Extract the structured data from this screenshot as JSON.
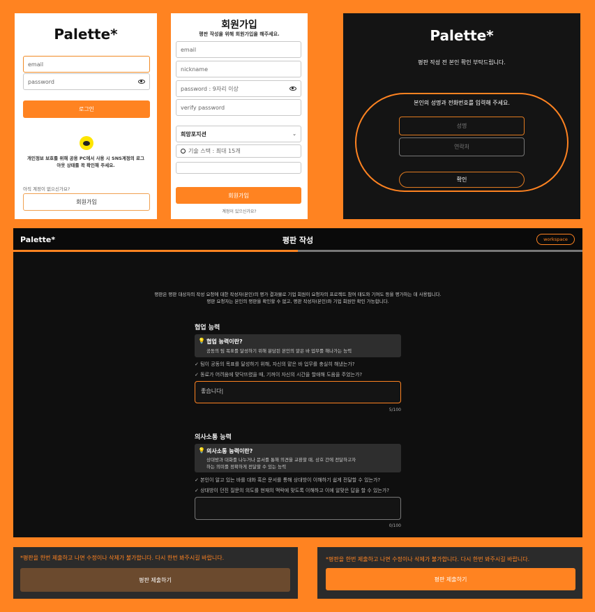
{
  "login": {
    "logo": "Palette*",
    "email_placeholder": "email",
    "password_placeholder": "password",
    "login_button": "로그인",
    "notice": "개인정보 보호를 위해 공용 PC에서 사용 시 SNS계정의 로그아웃 상태를 꼭 확인해 주세요.",
    "no_account": "아직 계정이 없으신가요?",
    "signup_button": "회원가입"
  },
  "signup": {
    "title": "회원가입",
    "subtitle": "평판 작성을 위해 회원가입을 해주세요.",
    "email_placeholder": "email",
    "nickname_placeholder": "nickname",
    "password_placeholder": "password : 9자리 이상",
    "verify_placeholder": "verify password",
    "position_select": "희망포지션",
    "skill_placeholder": "기술 스택 : 최대 15개",
    "signup_button": "회원가입",
    "have_account": "계정이 있으신가요?"
  },
  "verify": {
    "logo": "Palette*",
    "heading": "평판 작성 전 본인 확인 부탁드립니다.",
    "instruction": "본인의 성명과 전화번호를 입력해 주세요.",
    "name_placeholder": "성명",
    "phone_placeholder": "연락처",
    "confirm_button": "확인"
  },
  "review": {
    "logo": "Palette*",
    "title": "평판 작성",
    "workspace_button": "workspace",
    "progress": 0.5,
    "intro_line1": "평판은 평판 대상자의 작성 요청에 대한 작성자(본인)의 평가 결과물로 기업 회원이 요청자의 프로젝트 참여 태도와 기여도 등을 평가하는 데 사용됩니다.",
    "intro_line2": "평판 요청자는 본인의 평판을 확인할 수 없고, 평판 작성자(본인)와 기업 회원만 확인 가능합니다.",
    "sections": [
      {
        "title": "협업 능력",
        "tip_title": "협업 능력이란?",
        "tip_desc1": "공동의 팀 목표를 달성하기 위해 분담된 본인의 맡은 바 업무를 해나가는 능력",
        "tip_desc2": "",
        "check1": "✓ 팀이 공동의 목표를 달성하기 위해, 자신의 맡은 바 업무를 충실히 해냈는가?",
        "check2": "✓ 동료가 어려움에 맞닥뜨렸을 때, 기꺼이 자신의 시간을 할애해 도움을 주었는가?",
        "answer": "좋습니다|",
        "counter": "5/100"
      },
      {
        "title": "의사소통 능력",
        "tip_title": "의사소통 능력이란?",
        "tip_desc1": "상대방과 대화를 나누거나 문서를 통해 의견을 교환할 때, 상호 간에 전달하고자",
        "tip_desc2": "하는 의미를 정확하게 전달할 수 있는 능력",
        "check1": "✓ 본인이 알고 있는 바를 대화 혹은 문서를 통해 상대방이 이해하기 쉽게 전달할 수 있는가?",
        "check2": "✓ 상대방이 던진 질문의 의도를 현재의 맥락에 맞도록 이해하고 이에 알맞은 답을 할 수 있는가?",
        "answer": "",
        "counter": "0/100"
      }
    ]
  },
  "submit_disabled": {
    "warning": "*평판을 한번 제출하고 나면 수정이나 삭제가 불가합니다. 다시 한번 봐주시길 바랍니다.",
    "button": "평판 제출하기"
  },
  "submit_enabled": {
    "warning": "*평판을 한번 제출하고 나면 수정이나 삭제가 불가합니다. 다시 한번 봐주시길 바랍니다.",
    "button": "평판 제출하기"
  },
  "colors": {
    "accent": "#FF8321",
    "dark": "#141414",
    "kakao": "#FEE500"
  }
}
